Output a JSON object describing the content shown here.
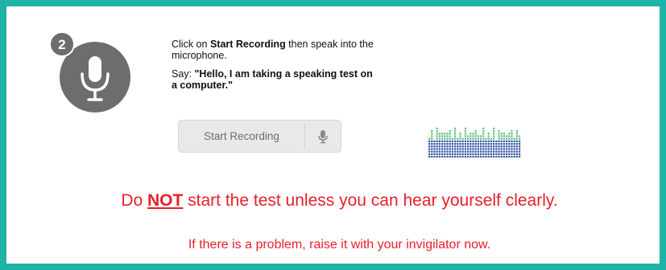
{
  "step": {
    "number": "2",
    "icon": "microphone-icon",
    "icon_color": "#6d6d6d"
  },
  "instructions": {
    "line1_prefix": "Click on ",
    "line1_bold": "Start Recording",
    "line1_suffix": " then speak into the microphone.",
    "say_prefix": "Say: ",
    "say_bold": "\"Hello, I am taking a speaking test on a computer.\""
  },
  "record_button": {
    "label": "Start Recording",
    "icon": "microphone-icon"
  },
  "warning": {
    "prefix": "Do ",
    "emphasis": "NOT",
    "suffix": " start the test unless you can hear yourself clearly."
  },
  "note": "If there is a problem, raise it with your invigilator now.",
  "colors": {
    "frame": "#1fb2a6",
    "alert_text": "#e8202a",
    "meter_top": "#5fbf7a",
    "meter_bottom": "#2c4fa3"
  }
}
